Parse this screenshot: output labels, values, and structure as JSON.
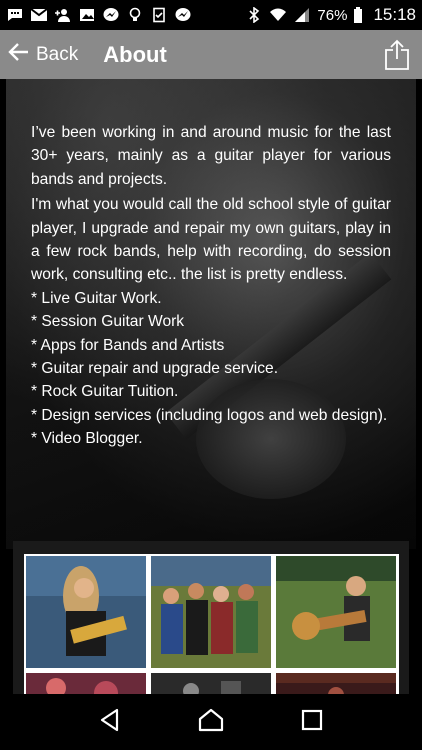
{
  "status_bar": {
    "icons": [
      "chat-icon",
      "gmail-icon",
      "add-person-icon",
      "image-icon",
      "messenger-icon",
      "lightbulb-icon",
      "clipboard-check-icon",
      "messenger-icon",
      "bluetooth-icon",
      "wifi-icon",
      "signal-icon"
    ],
    "battery": "76%",
    "time": "15:18"
  },
  "app_bar": {
    "back_label": "Back",
    "title": "About",
    "share_icon": "share-icon",
    "background": "#8a8a8a"
  },
  "about": {
    "paragraphs": [
      "I’ve been working in and around music for the last 30+ years, mainly as a guitar player for various bands and projects.",
      "I'm what you would call the old school style of guitar player, I upgrade and repair my own guitars, play in a few rock bands, help with recording, do session work, consulting etc.. the list is pretty endless."
    ],
    "services": [
      "* Live Guitar Work.",
      "* Session Guitar Work",
      "* Apps for Bands and Artists",
      "* Guitar repair and upgrade service.",
      "* Rock Guitar Tuition.",
      "* Design services (including logos and web design).",
      "* Video Blogger."
    ]
  },
  "gallery": {
    "photos": [
      "guitarist-stage-photo",
      "crowd-festival-photo",
      "guitarist-outdoor-photo",
      "stage-lights-photo",
      "band-stage-photo",
      "venue-photo"
    ]
  },
  "nav_bar": {
    "icons": [
      "back-triangle-icon",
      "home-icon",
      "recents-icon"
    ]
  }
}
